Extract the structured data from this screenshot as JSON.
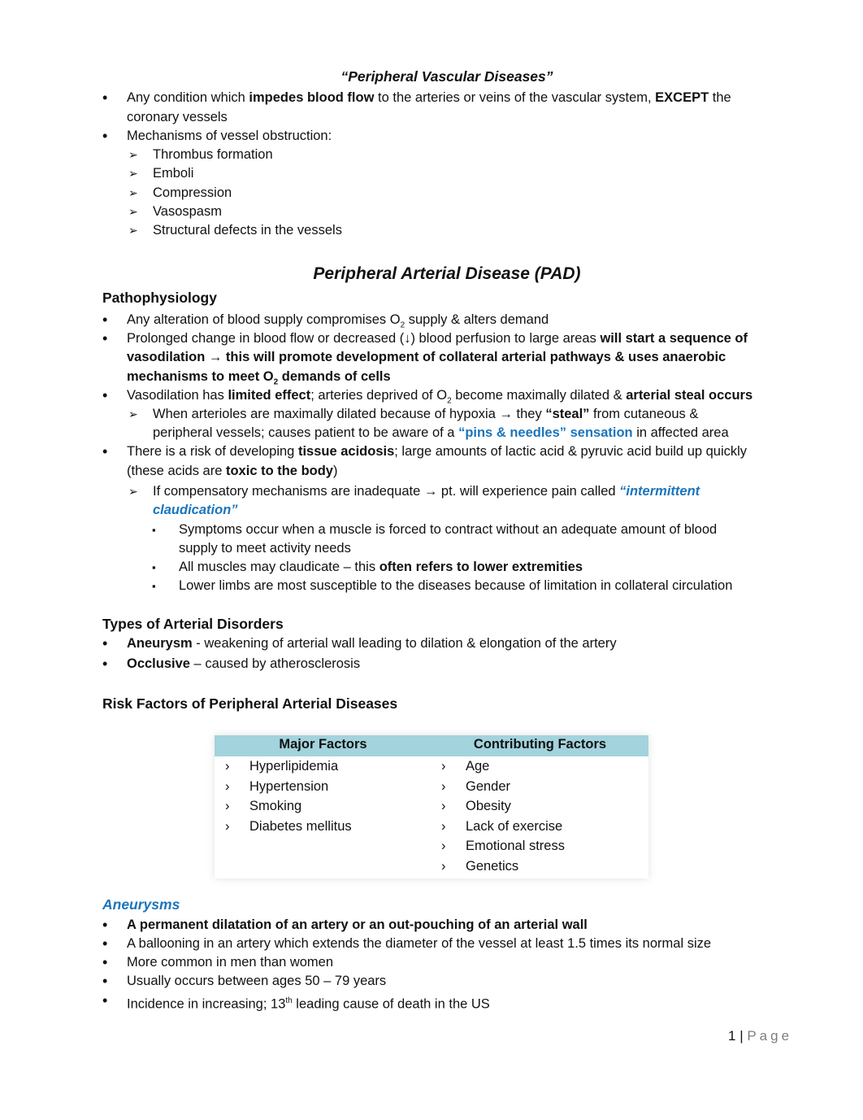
{
  "doc_title": "“Peripheral Vascular Diseases”",
  "intro": {
    "bullet1": {
      "a": "Any condition which ",
      "b": "impedes blood flow",
      "c": " to the arteries or veins of the vascular system, ",
      "d": "EXCEPT",
      "e": " the",
      "cont": "coronary vessels"
    },
    "bullet2": "Mechanisms of vessel obstruction:",
    "mechanisms": [
      "Thrombus formation",
      "Emboli",
      "Compression",
      "Vasospasm",
      "Structural defects in the vessels"
    ]
  },
  "pad": {
    "title": "Peripheral Arterial Disease (PAD)",
    "patho_heading": "Pathophysiology",
    "p1": {
      "a": "Any alteration of blood supply compromises O",
      "sub": "2",
      "b": " supply & alters demand"
    },
    "p2": {
      "a": "Prolonged change in blood flow or decreased (↓) blood perfusion to large areas ",
      "b": "will start a sequence of",
      "l2": "vasodilation → this will promote development of collateral arterial pathways & uses anaerobic",
      "l3a": "mechanisms to meet O",
      "sub": "2",
      "l3b": " demands of cells"
    },
    "p3": {
      "a": "Vasodilation has ",
      "b": "limited effect",
      "c": "; arteries deprived of O",
      "sub": "2",
      "d": " become maximally dilated & ",
      "e": "arterial steal occurs"
    },
    "p3_sub": {
      "a": "When arterioles are maximally dilated because of hypoxia → they ",
      "b": "“steal”",
      "c": " from cutaneous &",
      "l2a": "peripheral vessels; causes patient to be aware of a ",
      "l2b": "“pins & needles” sensation",
      "l2c": " in affected area"
    },
    "p4": {
      "a": "There is a risk of developing ",
      "b": "tissue acidosis",
      "c": "; large amounts of lactic acid & pyruvic acid build up quickly",
      "l2a": "(these acids are ",
      "l2b": "toxic to the body",
      "l2c": ")"
    },
    "p4_sub": {
      "a": "If compensatory mechanisms are inadequate → pt. will experience pain called ",
      "b": "“intermittent",
      "l2": "claudication”"
    },
    "p4_subsub": {
      "s1": "Symptoms occur when a muscle is forced to contract without an adequate amount of blood",
      "s1_cont": "supply to meet activity needs",
      "s2a": "All muscles may claudicate – this ",
      "s2b": "often refers to lower extremities",
      "s3": "Lower limbs are most susceptible to the diseases because of limitation in collateral circulation"
    }
  },
  "types": {
    "heading": "Types of Arterial Disorders",
    "t1": {
      "a": "Aneurysm",
      "b": " - weakening of arterial wall leading to dilation & elongation of the artery"
    },
    "t2": {
      "a": "Occlusive",
      "b": " – caused by atherosclerosis"
    }
  },
  "risk": {
    "heading": "Risk Factors of Peripheral Arterial Diseases",
    "table": {
      "headers": [
        "Major Factors",
        "Contributing Factors"
      ],
      "chevron": "›",
      "major": [
        "Hyperlipidemia",
        "Hypertension",
        "Smoking",
        "Diabetes mellitus"
      ],
      "contributing": [
        "Age",
        "Gender",
        "Obesity",
        "Lack of exercise",
        "Emotional stress",
        "Genetics"
      ]
    }
  },
  "aneurysms": {
    "heading": "Aneurysms",
    "a1": "A permanent dilatation of an artery or an out-pouching of an arterial wall",
    "a2": "A ballooning in an artery which extends the diameter of the vessel at least 1.5 times its normal size",
    "a3": "More common in men than women",
    "a4": "Usually occurs between ages 50 – 79 years",
    "a5": {
      "a": "Incidence in increasing; 13",
      "sup": "th",
      "b": " leading cause of death in the US"
    }
  },
  "footer": {
    "page_number": "1",
    "separator": " | ",
    "page_label": "Page"
  }
}
